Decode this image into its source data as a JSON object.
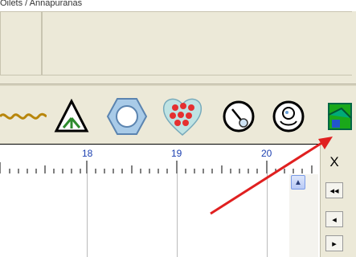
{
  "top_text": "Oilets / Annapuranas",
  "icons": [
    "chain-symbol",
    "triangle-y-symbol",
    "hexagon-symbol",
    "heart-dots-symbol",
    "compass-symbol",
    "face-symbol",
    "green-image-symbol"
  ],
  "ruler": {
    "labels": [
      "18",
      "19",
      "20"
    ]
  },
  "controls": {
    "close_label": "X",
    "fast_back": "◂◂",
    "back": "◂",
    "forward": "▸"
  },
  "accent": {
    "arrow": "#e02020",
    "ruler_text": "#1b3fb0"
  }
}
